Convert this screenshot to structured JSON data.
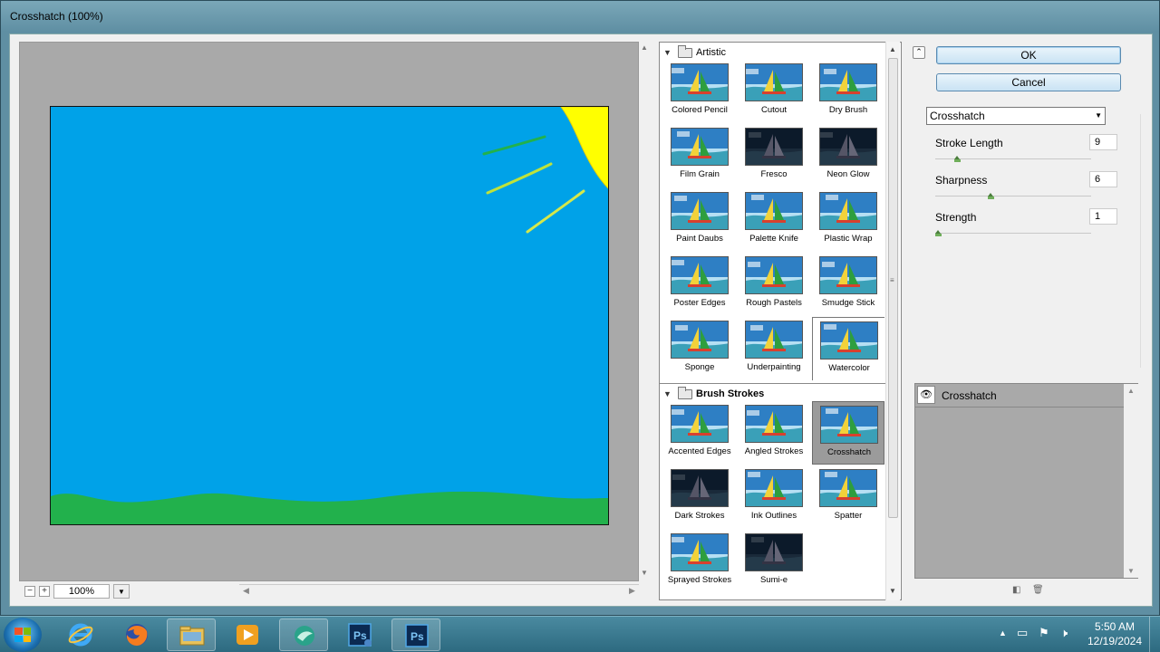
{
  "window": {
    "title": "Crosshatch (100%)"
  },
  "zoom": {
    "minus": "−",
    "plus": "+",
    "value": "100%"
  },
  "gallery": {
    "categories": {
      "artistic": "Artistic",
      "brush_strokes": "Brush Strokes"
    },
    "artistic_filters": [
      "Colored Pencil",
      "Cutout",
      "Dry Brush",
      "Film Grain",
      "Fresco",
      "Neon Glow",
      "Paint Daubs",
      "Palette Knife",
      "Plastic Wrap",
      "Poster Edges",
      "Rough Pastels",
      "Smudge Stick",
      "Sponge",
      "Underpainting",
      "Watercolor"
    ],
    "brush_filters": [
      "Accented Edges",
      "Angled Strokes",
      "Crosshatch",
      "Dark Strokes",
      "Ink Outlines",
      "Spatter",
      "Sprayed Strokes",
      "Sumi-e"
    ],
    "selected": "Crosshatch"
  },
  "buttons": {
    "ok": "OK",
    "cancel": "Cancel"
  },
  "filter_select": {
    "value": "Crosshatch"
  },
  "params": {
    "stroke_length": {
      "label": "Stroke Length",
      "value": "9",
      "fraction": 0.13
    },
    "sharpness": {
      "label": "Sharpness",
      "value": "6",
      "fraction": 0.35
    },
    "strength": {
      "label": "Strength",
      "value": "1",
      "fraction": 0.0
    }
  },
  "layers": [
    {
      "name": "Crosshatch"
    }
  ],
  "taskbar": {
    "items": [
      "internet-explorer",
      "firefox",
      "file-explorer",
      "media-player",
      "app-bird",
      "photoshop-installer",
      "photoshop"
    ],
    "time": "5:50 AM",
    "date": "12/19/2024"
  },
  "colors": {
    "sky": "#00a2e8",
    "grass": "#22b14c",
    "sun": "#ffff00",
    "selection": "#9b9b9b"
  }
}
